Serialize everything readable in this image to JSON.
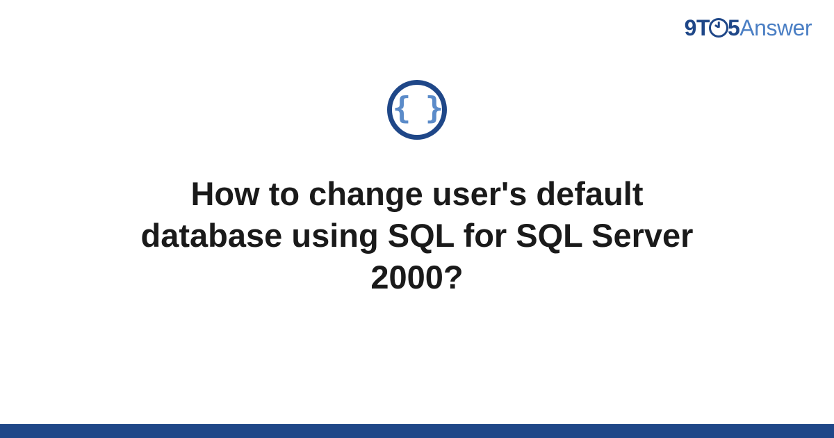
{
  "brand": {
    "part1": "9T",
    "part2": "5",
    "part3": "Answer"
  },
  "icon": {
    "braces": "{ }"
  },
  "question": {
    "title": "How to change user's default database using SQL for SQL Server 2000?"
  }
}
